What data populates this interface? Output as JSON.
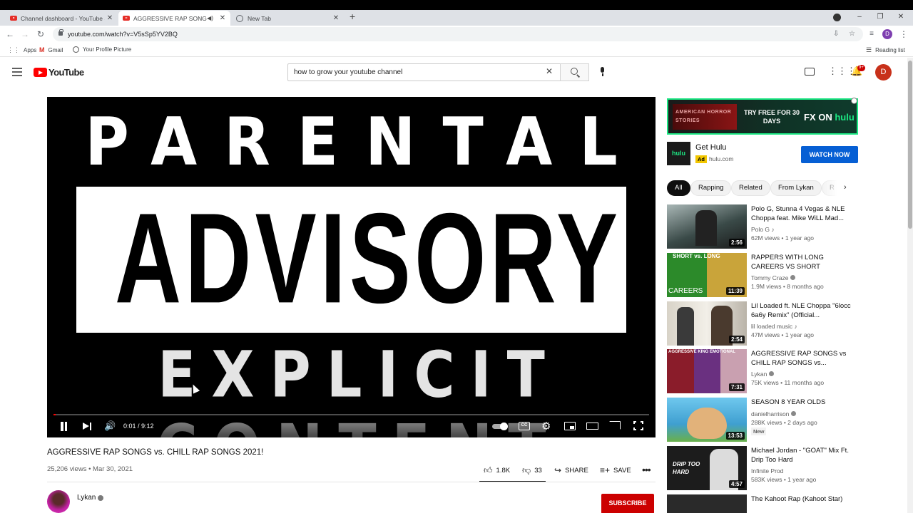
{
  "browser": {
    "tabs": [
      {
        "title": "Channel dashboard - YouTube Studio",
        "active": false
      },
      {
        "title": "AGGRESSIVE RAP SONGS vs. CHILL RAP SONGS 2021!",
        "active": true
      },
      {
        "title": "New Tab",
        "active": false
      }
    ],
    "new_tab": "+",
    "url": "youtube.com/watch?v=V5sSp5YV2BQ",
    "profile_initial": "D",
    "bookmarks": [
      "Apps",
      "Gmail",
      "Your Profile Picture"
    ],
    "reading_list": "Reading list",
    "window_controls": {
      "minimize": "–",
      "restore": "❐",
      "close": "✕"
    }
  },
  "youtube": {
    "logo": "YouTube",
    "search_query": "how to grow your youtube channel",
    "notification_count": "9+",
    "avatar_initial": "D"
  },
  "player": {
    "frame_text": {
      "line1": "PARENTAL",
      "line2": "ADVISORY",
      "line3": "EXPLICIT CONTENT"
    },
    "time": "0:01 / 9:12",
    "progress": 0.002,
    "cc_label": "CC"
  },
  "video": {
    "title": "AGGRESSIVE RAP SONGS vs. CHILL RAP SONGS 2021!",
    "meta": "25,206 views • Mar 30, 2021",
    "likes": "1.8K",
    "dislikes": "33",
    "share_label": "SHARE",
    "save_label": "SAVE",
    "channel": "Lykan",
    "subscribe_label": "SUBSCRIBE"
  },
  "ad": {
    "banner_left": "AMERICAN HORROR STORIES",
    "banner_tagline": "TRY FREE FOR 30 DAYS",
    "banner_brand_fx": "FX ON ",
    "banner_brand_hulu": "hulu",
    "logo_text": "hulu",
    "title": "Get Hulu",
    "badge": "Ad",
    "url": "hulu.com",
    "cta": "WATCH NOW"
  },
  "chips": [
    "All",
    "Rapping",
    "Related",
    "From Lykan",
    "R"
  ],
  "recommendations": [
    {
      "title": "Polo G, Stunna 4 Vegas & NLE Choppa feat. Mike WiLL Mad...",
      "channel": "Polo G ♪",
      "meta": "62M views • 1 year ago",
      "duration": "2:56",
      "thumb_color": "#5a6b6a",
      "overlay": ""
    },
    {
      "title": "RAPPERS WITH LONG CAREERS VS SHORT CAREER...",
      "channel": "Tommy Craze",
      "meta": "1.9M views • 8 months ago",
      "duration": "11:39",
      "thumb_color": "#2f7a2a",
      "overlay": "SHORT vs. LONG"
    },
    {
      "title": "Lil Loaded ft. NLE Choppa \"6locc 6a6y Remix\" (Official...",
      "channel": "lil loaded music ♪",
      "meta": "47M views • 1 year ago",
      "duration": "2:54",
      "thumb_color": "#c8c2b6",
      "overlay": ""
    },
    {
      "title": "AGGRESSIVE RAP SONGS vs CHILL RAP SONGS vs...",
      "channel": "Lykan",
      "meta": "75K views • 11 months ago",
      "duration": "7:31",
      "thumb_color": "#6b2a6a",
      "overlay": "AGGRESSIVE KING EMOTIONAL"
    },
    {
      "title": "SEASON 8 YEAR OLDS",
      "channel": "danielharrison",
      "meta": "288K views • 2 days ago",
      "duration": "13:53",
      "thumb_color": "#5fb8e0",
      "overlay": "",
      "badge": "New"
    },
    {
      "title": "Michael Jordan - \"GOAT\" Mix Ft. Drip Too Hard",
      "channel": "Infinite Prod",
      "meta": "583K views • 1 year ago",
      "duration": "4:57",
      "thumb_color": "#1c1c1c",
      "overlay": "DRIP TOO HARD"
    },
    {
      "title": "The Kahoot Rap (Kahoot Star)",
      "channel": "",
      "meta": "",
      "duration": "",
      "thumb_color": "#2a2a2a",
      "overlay": ""
    }
  ]
}
